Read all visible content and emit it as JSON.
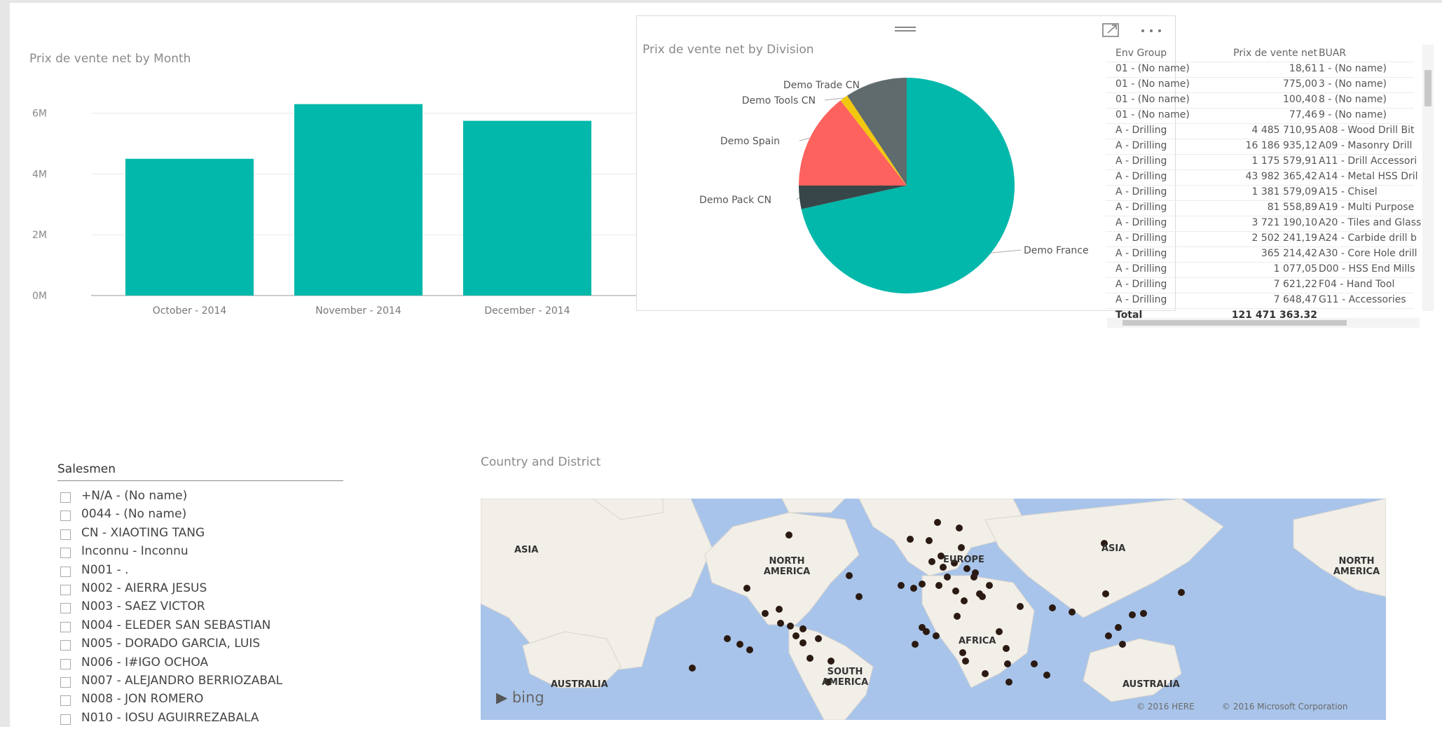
{
  "bar_chart": {
    "title": "Prix de vente net by Month",
    "color": "#01b8aa",
    "y_ticks": [
      "0M",
      "2M",
      "4M",
      "6M"
    ]
  },
  "pie_chart": {
    "title": "Prix de vente net by Division"
  },
  "table": {
    "headers": [
      "Env Group",
      "Prix de vente net",
      "BUAR"
    ],
    "rows": [
      [
        "01 - (No name)",
        "18,61",
        "1 - (No name)"
      ],
      [
        "01 - (No name)",
        "775,00",
        "3 - (No name)"
      ],
      [
        "01 - (No name)",
        "100,40",
        "8 - (No name)"
      ],
      [
        "01 - (No name)",
        "77,46",
        "9 - (No name)"
      ],
      [
        "A - Drilling",
        "4 485 710,95",
        "A08 - Wood Drill Bit"
      ],
      [
        "A - Drilling",
        "16 186 935,12",
        "A09 - Masonry Drill"
      ],
      [
        "A - Drilling",
        "1 175 579,91",
        "A11 - Drill Accessori"
      ],
      [
        "A - Drilling",
        "43 982 365,42",
        "A14 - Metal HSS Dril"
      ],
      [
        "A - Drilling",
        "1 381 579,09",
        "A15 - Chisel"
      ],
      [
        "A - Drilling",
        "81 558,89",
        "A19 - Multi Purpose"
      ],
      [
        "A - Drilling",
        "3 721 190,10",
        "A20 - Tiles and Glass"
      ],
      [
        "A - Drilling",
        "2 502 241,19",
        "A24 - Carbide drill b"
      ],
      [
        "A - Drilling",
        "365 214,42",
        "A30 - Core Hole drill"
      ],
      [
        "A - Drilling",
        "1 077,05",
        "D00 - HSS End Mills"
      ],
      [
        "A - Drilling",
        "7 621,22",
        "F04 - Hand Tool"
      ],
      [
        "A - Drilling",
        "7 648,47",
        "G11 - Accessories"
      ]
    ],
    "total_label": "Total",
    "total_value": "121 471 363,32",
    "scroll_left": "<",
    "scroll_right": ">",
    "scroll_up": "^",
    "scroll_down": "v"
  },
  "slicer": {
    "header": "Salesmen",
    "items": [
      "+N/A - (No name)",
      "0044 - (No name)",
      "CN - XIAOTING TANG",
      "Inconnu - Inconnu",
      "N001 - .",
      "N002 - AIERRA JESUS",
      "N003 - SAEZ VICTOR",
      "N004 - ELEDER SAN SEBASTIAN",
      "N005 - DORADO GARCIA, LUIS",
      "N006 - I#IGO OCHOA",
      "N007 - ALEJANDRO BERRIOZABAL",
      "N008 - JON ROMERO",
      "N010 - IOSU AGUIRREZABALA"
    ]
  },
  "map": {
    "title": "Country and District",
    "labels": [
      "ASIA",
      "NORTH AMERICA",
      "EUROPE",
      "ASIA",
      "NORTH AMERICA",
      "AFRICA",
      "SOUTH AMERICA",
      "AUSTRALIA",
      "AUSTRALIA"
    ],
    "bing": "bing",
    "copyright_here": "© 2016 HERE",
    "copyright_ms": "© 2016 Microsoft Corporation",
    "ocean_color": "#a8c4ea",
    "land_color": "#f2efe9",
    "marker_color": "#2b1a12"
  },
  "icons": {
    "drag": "drag-handle-icon",
    "focus": "focus-mode-icon",
    "more": "more-options-icon"
  },
  "chart_data": [
    {
      "type": "bar",
      "title": "Prix de vente net by Month",
      "categories": [
        "October - 2014",
        "November - 2014",
        "December - 2014"
      ],
      "values": [
        4500000,
        6300000,
        5750000
      ],
      "ylim": [
        0,
        6500000
      ],
      "grid": true
    },
    {
      "type": "pie",
      "title": "Prix de vente net by Division",
      "categories": [
        "Demo France",
        "Demo Pack CN",
        "Demo Spain",
        "Demo Tools CN",
        "Demo Trade CN"
      ],
      "values": [
        71.5,
        3.5,
        14.5,
        1.2,
        9.3
      ],
      "colors": [
        "#01b8aa",
        "#374649",
        "#fd625e",
        "#f2c80f",
        "#5f6b6d"
      ]
    }
  ]
}
